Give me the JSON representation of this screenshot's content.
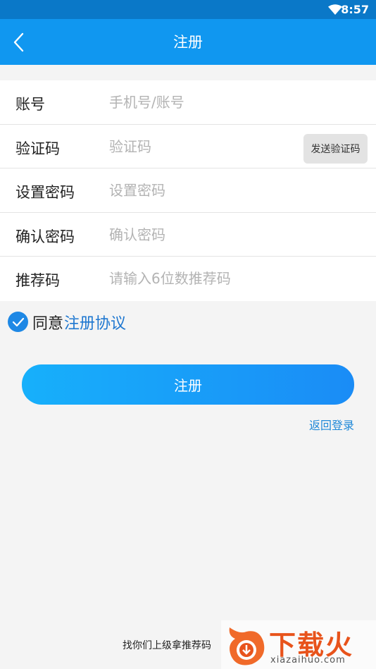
{
  "status_bar": {
    "time": "8:57"
  },
  "app_bar": {
    "title": "注册"
  },
  "form": {
    "fields": [
      {
        "label": "账号",
        "placeholder": "手机号/账号"
      },
      {
        "label": "验证码",
        "placeholder": "验证码"
      },
      {
        "label": "设置密码",
        "placeholder": "设置密码"
      },
      {
        "label": "确认密码",
        "placeholder": "确认密码"
      },
      {
        "label": "推荐码",
        "placeholder": "请输入6位数推荐码"
      }
    ],
    "send_code_label": "发送验证码"
  },
  "agreement": {
    "checked": true,
    "prefix": "同意",
    "link": "注册协议"
  },
  "register_button": "注册",
  "back_to_login": "返回登录",
  "footer_hint": "找你们上级拿推荐码",
  "watermark": {
    "text": "下载火",
    "sub": "xiazaihuo.com"
  },
  "colors": {
    "accent": "#1097f0",
    "status_bar": "#0a78c8",
    "link": "#1e77d0"
  }
}
